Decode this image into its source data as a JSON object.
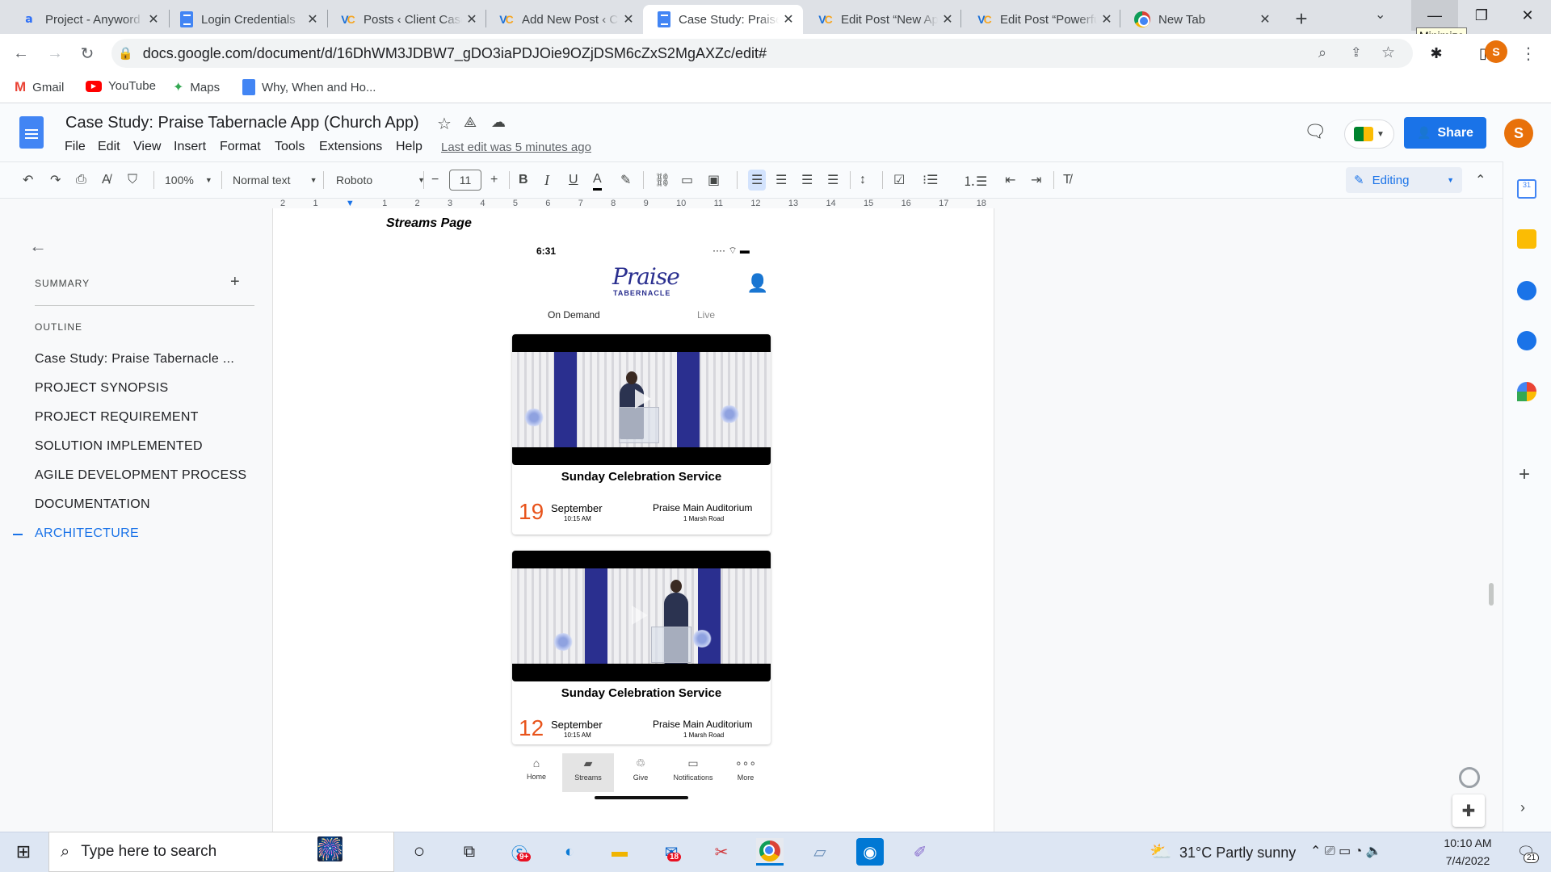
{
  "browser": {
    "tabs": [
      {
        "title": "Project - Anyword",
        "icon": "anyword-icon",
        "active": false
      },
      {
        "title": "Login Credentials",
        "icon": "google-docs-icon",
        "active": false
      },
      {
        "title": "Posts ‹ Client Case",
        "icon": "vc-icon",
        "active": false
      },
      {
        "title": "Add New Post ‹ C",
        "icon": "vc-icon",
        "active": false
      },
      {
        "title": "Case Study: Praise",
        "icon": "google-docs-icon",
        "active": true
      },
      {
        "title": "Edit Post “New Ap",
        "icon": "vc-icon",
        "active": false
      },
      {
        "title": "Edit Post “Powerfu",
        "icon": "vc-icon",
        "active": false
      },
      {
        "title": "New Tab",
        "icon": "chrome-icon",
        "active": false
      }
    ],
    "new_tab_symbol": "+",
    "tooltip": "Minimize",
    "url": "docs.google.com/document/d/16DhWM3JDBW7_gDO3iaPDJOie9OZjDSM6cZxS2MgAXZc/edit#",
    "profile_initial": "S",
    "bookmarks": [
      "Gmail",
      "YouTube",
      "Maps",
      "Why, When and Ho..."
    ]
  },
  "docs": {
    "title": "Case Study: Praise Tabernacle App (Church App)",
    "menus": [
      "File",
      "Edit",
      "View",
      "Insert",
      "Format",
      "Tools",
      "Extensions",
      "Help"
    ],
    "last_edit": "Last edit was 5 minutes ago",
    "share_label": "Share",
    "avatar_initial": "S",
    "toolbar": {
      "zoom": "100%",
      "style": "Normal text",
      "font": "Roboto",
      "font_size": "11",
      "mode": "Editing"
    },
    "ruler_ticks": [
      "2",
      "1",
      "",
      "1",
      "2",
      "3",
      "4",
      "5",
      "6",
      "7",
      "8",
      "9",
      "10",
      "11",
      "12",
      "13",
      "14",
      "15",
      "16",
      "17",
      "18"
    ],
    "sidebar": {
      "summary_label": "SUMMARY",
      "outline_label": "OUTLINE",
      "items": [
        {
          "label": "Case Study: Praise Tabernacle ...",
          "active": false
        },
        {
          "label": "PROJECT SYNOPSIS",
          "active": false
        },
        {
          "label": "PROJECT REQUIREMENT",
          "active": false
        },
        {
          "label": "SOLUTION IMPLEMENTED",
          "active": false
        },
        {
          "label": "AGILE DEVELOPMENT PROCESS",
          "active": false
        },
        {
          "label": "DOCUMENTATION",
          "active": false
        },
        {
          "label": "ARCHITECTURE",
          "active": true
        }
      ]
    },
    "body": {
      "heading": "Streams Page"
    }
  },
  "app_mock": {
    "time": "6:31",
    "logo_script": "Praise",
    "logo_sub": "TABERNACLE",
    "tabs": [
      "On Demand",
      "Live"
    ],
    "cards": [
      {
        "title": "Sunday Celebration Service",
        "day": "19",
        "month": "September",
        "time": "10:15 AM",
        "venue": "Praise Main Auditorium",
        "address": "1 Marsh Road"
      },
      {
        "title": "Sunday Celebration Service",
        "day": "12",
        "month": "September",
        "time": "10:15 AM",
        "venue": "Praise Main Auditorium",
        "address": "1 Marsh Road"
      }
    ],
    "nav": [
      "Home",
      "Streams",
      "Give",
      "Notifications",
      "More"
    ]
  },
  "taskbar": {
    "search_placeholder": "Type here to search",
    "weather": "31°C  Partly sunny",
    "time": "10:10 AM",
    "date": "7/4/2022",
    "notif_count": "21",
    "badges": {
      "skype": "9+",
      "mail": "18"
    }
  },
  "colors": {
    "accent_blue": "#1a73e8",
    "date_orange": "#e8541c",
    "curtain_blue": "#2a2f8f",
    "profile_orange": "#e8710a"
  }
}
